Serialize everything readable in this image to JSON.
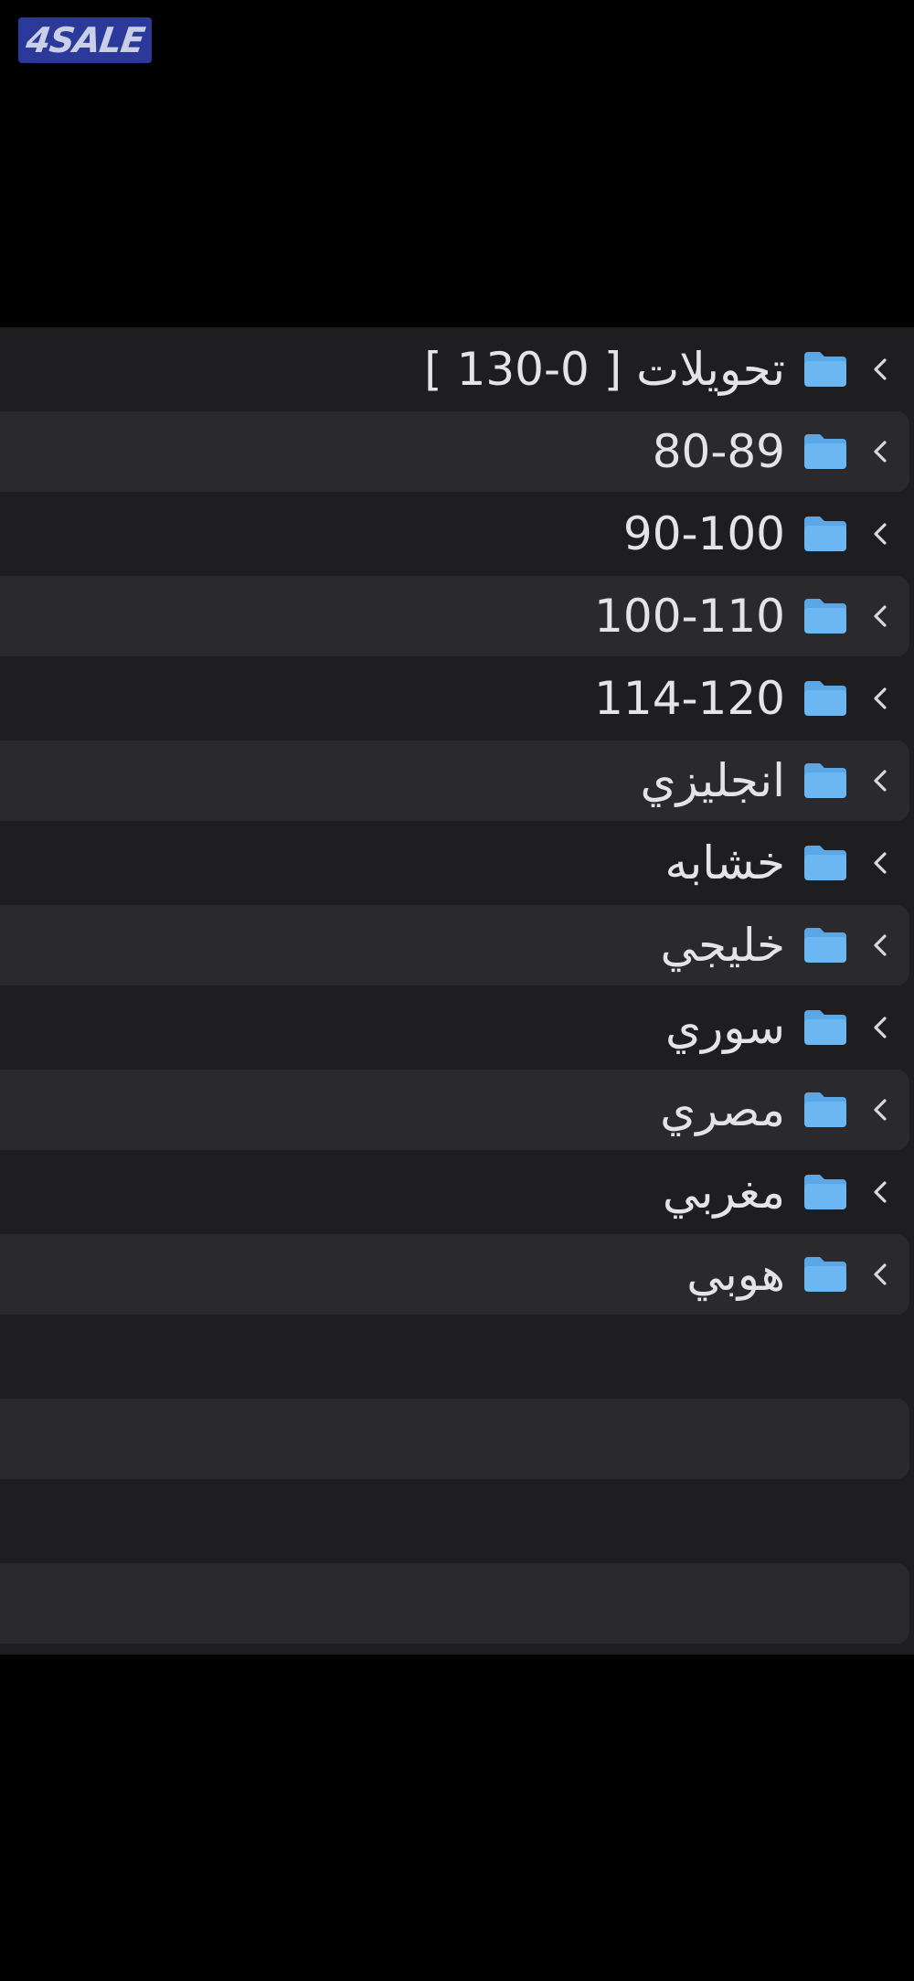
{
  "watermark": {
    "text": "4SALE"
  },
  "folders": [
    {
      "label": "تحويلات [ 0-130 ]",
      "icon": "folder-icon",
      "chevron": "chevron-left-icon"
    },
    {
      "label": "80-89",
      "icon": "folder-icon",
      "chevron": "chevron-left-icon"
    },
    {
      "label": "90-100",
      "icon": "folder-icon",
      "chevron": "chevron-left-icon"
    },
    {
      "label": "100-110",
      "icon": "folder-icon",
      "chevron": "chevron-left-icon"
    },
    {
      "label": "114-120",
      "icon": "folder-icon",
      "chevron": "chevron-left-icon"
    },
    {
      "label": "انجليزي",
      "icon": "folder-icon",
      "chevron": "chevron-left-icon"
    },
    {
      "label": "خشابه",
      "icon": "folder-icon",
      "chevron": "chevron-left-icon"
    },
    {
      "label": "خليجي",
      "icon": "folder-icon",
      "chevron": "chevron-left-icon"
    },
    {
      "label": "سوري",
      "icon": "folder-icon",
      "chevron": "chevron-left-icon"
    },
    {
      "label": "مصري",
      "icon": "folder-icon",
      "chevron": "chevron-left-icon"
    },
    {
      "label": "مغربي",
      "icon": "folder-icon",
      "chevron": "chevron-left-icon"
    },
    {
      "label": "هوبي",
      "icon": "folder-icon",
      "chevron": "chevron-left-icon"
    }
  ],
  "colors": {
    "background": "#000000",
    "panel": "#1e1e21",
    "row_alt": "#2a2a2e",
    "text": "#e4e4e6",
    "folder_blue": "#6cb6f2",
    "watermark_bg": "#2b3a9a"
  }
}
